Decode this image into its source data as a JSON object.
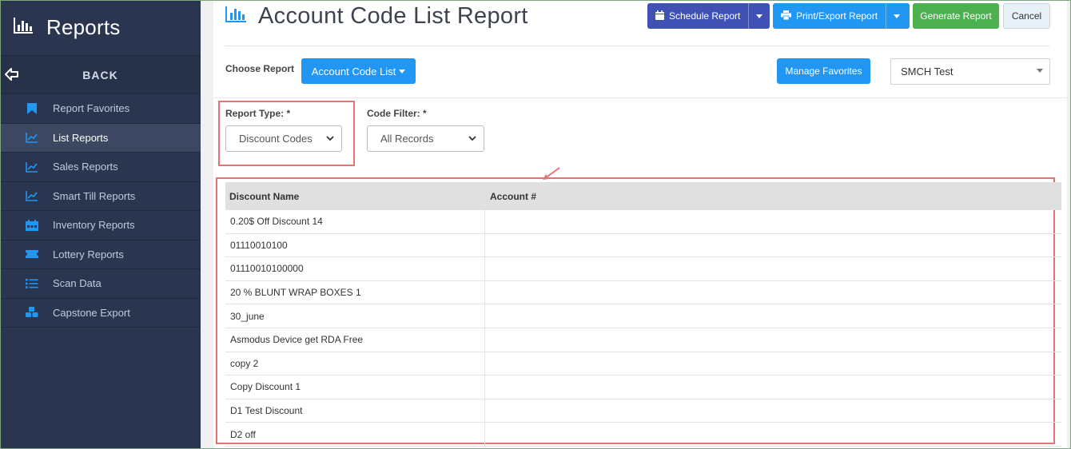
{
  "sidebar": {
    "title": "Reports",
    "back_label": "BACK",
    "items": [
      {
        "label": "Report Favorites",
        "icon": "bookmark-icon",
        "active": false
      },
      {
        "label": "List Reports",
        "icon": "line-chart-icon",
        "active": true
      },
      {
        "label": "Sales Reports",
        "icon": "line-chart-icon",
        "active": false
      },
      {
        "label": "Smart Till Reports",
        "icon": "line-chart-icon",
        "active": false
      },
      {
        "label": "Inventory Reports",
        "icon": "warehouse-icon",
        "active": false
      },
      {
        "label": "Lottery Reports",
        "icon": "ticket-icon",
        "active": false
      },
      {
        "label": "Scan Data",
        "icon": "list-icon",
        "active": false
      },
      {
        "label": "Capstone Export",
        "icon": "cubes-icon",
        "active": false
      }
    ]
  },
  "header": {
    "title": "Account Code List Report",
    "schedule_label": "Schedule Report",
    "print_label": "Print/Export Report",
    "generate_label": "Generate Report",
    "cancel_label": "Cancel"
  },
  "choose": {
    "label": "Choose Report",
    "report_button": "Account Code List",
    "favorites_button": "Manage Favorites",
    "store_value": "SMCH Test"
  },
  "filters": {
    "report_type_label": "Report Type: *",
    "report_type_value": "Discount Codes",
    "code_filter_label": "Code Filter: *",
    "code_filter_value": "All Records"
  },
  "table": {
    "columns": [
      "Discount Name",
      "Account #"
    ],
    "rows": [
      {
        "name": "0.20$ Off Discount 14",
        "account": ""
      },
      {
        "name": "01110010100",
        "account": ""
      },
      {
        "name": "01110010100000",
        "account": ""
      },
      {
        "name": "20 % BLUNT WRAP BOXES 1",
        "account": ""
      },
      {
        "name": "30_june",
        "account": ""
      },
      {
        "name": "Asmodus Device get RDA Free",
        "account": ""
      },
      {
        "name": "copy 2",
        "account": ""
      },
      {
        "name": "Copy Discount 1",
        "account": ""
      },
      {
        "name": "D1 Test Discount",
        "account": ""
      },
      {
        "name": "D2 off",
        "account": ""
      }
    ]
  },
  "colors": {
    "sidebar_bg": "#2a3650",
    "primary": "#2196f3",
    "schedule": "#3f51b5",
    "generate": "#4caf50",
    "highlight": "#e57373"
  }
}
